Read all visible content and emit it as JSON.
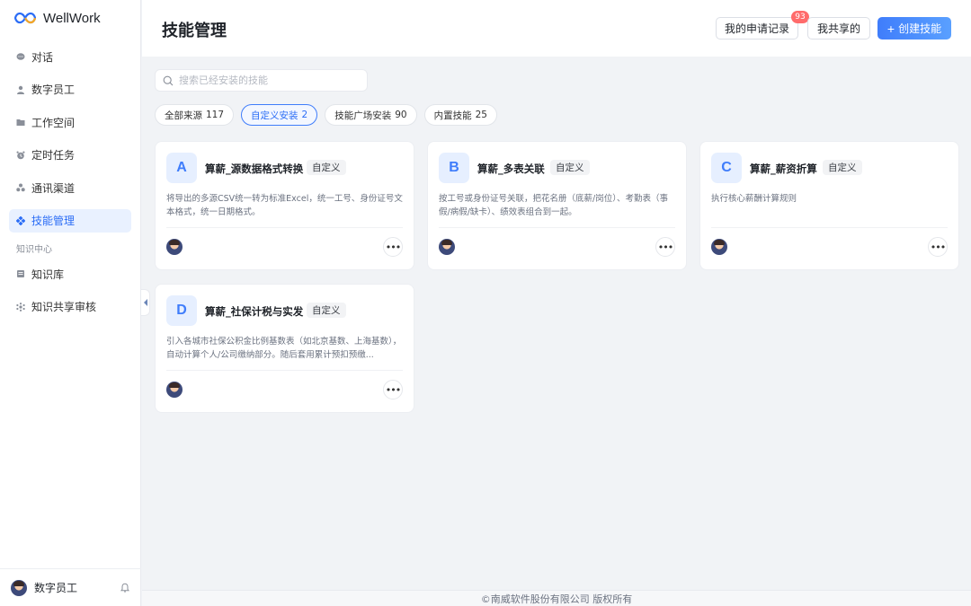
{
  "app": {
    "name": "WellWork"
  },
  "sidebar": {
    "items": [
      {
        "label": "对话",
        "icon": "chat-icon"
      },
      {
        "label": "数字员工",
        "icon": "user-icon"
      },
      {
        "label": "工作空间",
        "icon": "folder-icon"
      },
      {
        "label": "定时任务",
        "icon": "alarm-icon"
      },
      {
        "label": "通讯渠道",
        "icon": "channel-icon"
      },
      {
        "label": "技能管理",
        "icon": "skill-icon",
        "active": true
      }
    ],
    "section_label": "知识中心",
    "section_items": [
      {
        "label": "知识库",
        "icon": "book-icon"
      },
      {
        "label": "知识共享审核",
        "icon": "share-icon"
      }
    ],
    "user": {
      "name": "数字员工"
    }
  },
  "header": {
    "title": "技能管理",
    "records_label": "我的申请记录",
    "records_badge": "93",
    "shared_label": "我共享的",
    "create_label": "创建技能"
  },
  "search": {
    "placeholder": "搜索已经安装的技能",
    "value": ""
  },
  "filters": [
    {
      "label": "全部来源",
      "count": "117",
      "active": false
    },
    {
      "label": "自定义安装",
      "count": "2",
      "active": true
    },
    {
      "label": "技能广场安装",
      "count": "90",
      "active": false
    },
    {
      "label": "内置技能",
      "count": "25",
      "active": false
    }
  ],
  "skills": [
    {
      "letter": "A",
      "name": "算薪_源数据格式转换",
      "tag": "自定义",
      "description": "将导出的多源CSV统一转为标准Excel，统一工号、身份证号文本格式，统一日期格式。"
    },
    {
      "letter": "B",
      "name": "算薪_多表关联",
      "tag": "自定义",
      "description": "按工号或身份证号关联，把花名册（底薪/岗位）、考勤表（事假/病假/缺卡）、绩效表组合到一起。"
    },
    {
      "letter": "C",
      "name": "算薪_薪资折算",
      "tag": "自定义",
      "description": "执行核心薪酬计算规则"
    },
    {
      "letter": "D",
      "name": "算薪_社保计税与实发",
      "tag": "自定义",
      "description": "引入各城市社保公积金比例基数表（如北京基数、上海基数），自动计算个人/公司缴纳部分。随后套用累计预扣预缴..."
    }
  ],
  "footer": {
    "copyright": "©南威软件股份有限公司 版权所有"
  }
}
